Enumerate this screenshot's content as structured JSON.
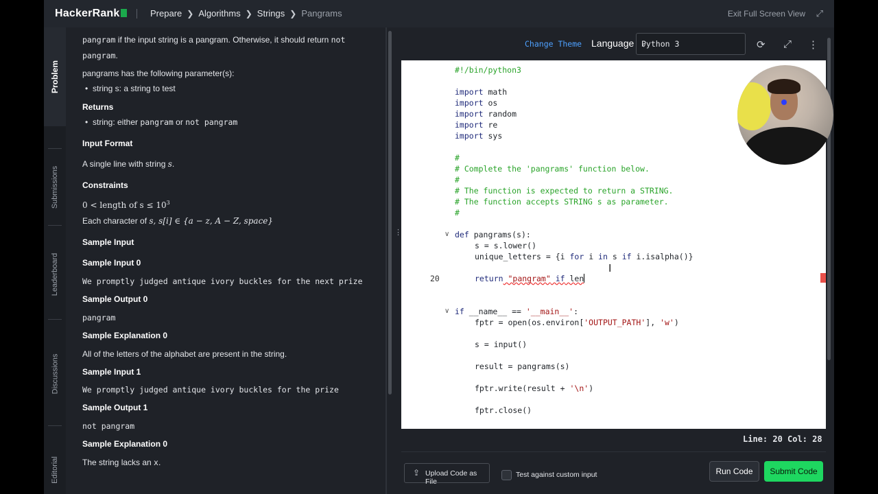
{
  "topbar": {
    "logo": "HackerRank",
    "breadcrumb": [
      "Prepare",
      "Algorithms",
      "Strings"
    ],
    "current": "Pangrams",
    "exit_full_screen": "Exit Full Screen View"
  },
  "side_tabs": {
    "problem": "Problem",
    "submissions": "Submissions",
    "leaderboard": "Leaderboard",
    "discussions": "Discussions",
    "editorial": "Editorial"
  },
  "problem": {
    "desc_line1_code": "pangram",
    "desc_line1_text": " if the input string is a pangram. Otherwise, it should return ",
    "desc_line1_code2": "not",
    "desc_line2_code": "pangram",
    "desc_line2_text": ".",
    "params_intro": "pangrams has the following parameter(s):",
    "param1": "string s: a string to test",
    "returns_heading": "Returns",
    "returns_text": "string: either ",
    "returns_code1": "pangram",
    "returns_or": " or ",
    "returns_code2": "not pangram",
    "input_format_heading": "Input Format",
    "input_format_text": "A single line with string ",
    "input_format_var": "s",
    "input_format_end": ".",
    "constraints_heading": "Constraints",
    "constraint1": "0 <  length of s ≤ 10",
    "constraint1_exp": "3",
    "constraint2_text": "Each character of ",
    "constraint2_math": "s, s[i] ∈ {a − z, A − Z, space}",
    "sample_input_heading": "Sample Input",
    "sample_input0_heading": "Sample Input 0",
    "sample_input0": "We promptly judged antique ivory buckles for the next prize",
    "sample_output0_heading": "Sample Output 0",
    "sample_output0": "pangram",
    "sample_expl0_heading": "Sample Explanation 0",
    "sample_expl0": "All of the letters of the alphabet are present in the string.",
    "sample_input1_heading": "Sample Input 1",
    "sample_input1": "We promptly judged antique ivory buckles for the prize",
    "sample_output1_heading": "Sample Output 1",
    "sample_output1": "not pangram",
    "sample_expl1_heading": "Sample Explanation 0",
    "sample_expl1_text": "The string lacks an ",
    "sample_expl1_code": "x",
    "sample_expl1_end": "."
  },
  "editor": {
    "change_theme": "Change Theme",
    "language_label": "Language",
    "language_value": "Python 3",
    "line_number": "20",
    "status": "Line: 20 Col: 28",
    "code": {
      "l1": "#!/bin/python3",
      "l3_kw": "import",
      "l3": " math",
      "l4_kw": "import",
      "l4": " os",
      "l5_kw": "import",
      "l5": " random",
      "l6_kw": "import",
      "l6": " re",
      "l7_kw": "import",
      "l7": " sys",
      "c1": "#",
      "c2": "# Complete the 'pangrams' function below.",
      "c3": "#",
      "c4": "# The function is expected to return a STRING.",
      "c5": "# The function accepts STRING s as parameter.",
      "c6": "#",
      "def_kw": "def",
      "def_rest": " pangrams(s):",
      "s_lower": "s = s.lower()",
      "unique_a": "unique_letters = {i ",
      "unique_for": "for",
      "unique_b": " i ",
      "unique_in": "in",
      "unique_c": " s ",
      "unique_if": "if",
      "unique_d": " i.isalpha()}",
      "ret_kw": "return",
      "ret_str": " \"pangram\"",
      "ret_if": " if",
      "ret_len": " len",
      "main_if": "if",
      "main_a": " __name__ == ",
      "main_str": "'__main__'",
      "main_b": ":",
      "fptr_a": "fptr = open(os.environ[",
      "fptr_s1": "'OUTPUT_PATH'",
      "fptr_b": "], ",
      "fptr_s2": "'w'",
      "fptr_c": ")",
      "s_input": "s = input()",
      "result": "result = pangrams(s)",
      "write_a": "fptr.write(result + ",
      "write_s": "'\\n'",
      "write_b": ")",
      "close": "fptr.close()"
    }
  },
  "footer": {
    "upload": "Upload Code as File",
    "custom_input": "Test against custom input",
    "run": "Run Code",
    "submit": "Submit Code"
  },
  "colors": {
    "accent_green": "#1ed760",
    "link_blue": "#4ea1ff",
    "comment_green": "#29a329"
  }
}
